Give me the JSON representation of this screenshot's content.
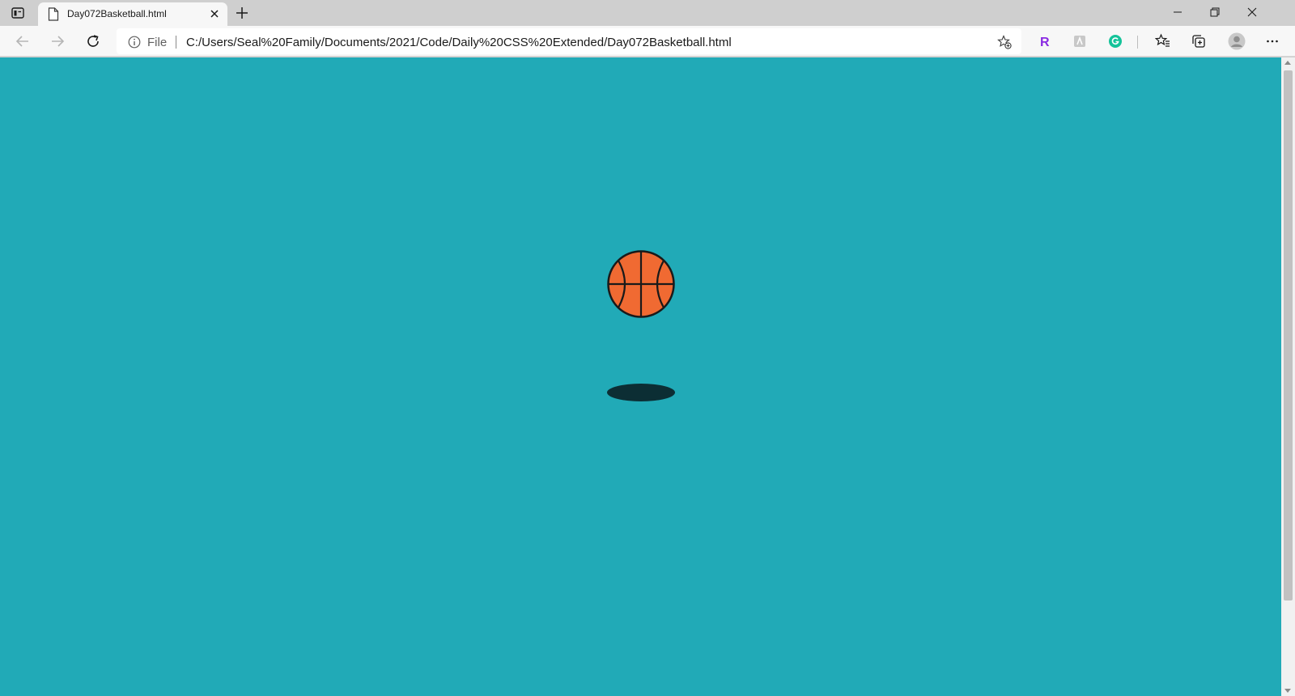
{
  "browser": {
    "tab": {
      "title": "Day072Basketball.html"
    },
    "address_bar": {
      "scheme_label": "File",
      "url": "C:/Users/Seal%20Family/Documents/2021/Code/Daily%20CSS%20Extended/Day072Basketball.html"
    },
    "extensions": [
      {
        "icon": "r-extension-icon",
        "letter": "R",
        "color": "#8a2be2"
      },
      {
        "icon": "puzzle-extension-icon",
        "color": "#9a9a9a"
      },
      {
        "icon": "grammarly-icon",
        "letter": "G",
        "color": "#15c39a"
      }
    ]
  },
  "page": {
    "background": "#21aab7",
    "ball": {
      "fill": "#f06a32",
      "stroke": "#1a1a1a"
    },
    "shadow": {
      "fill": "#0c2e34"
    }
  }
}
